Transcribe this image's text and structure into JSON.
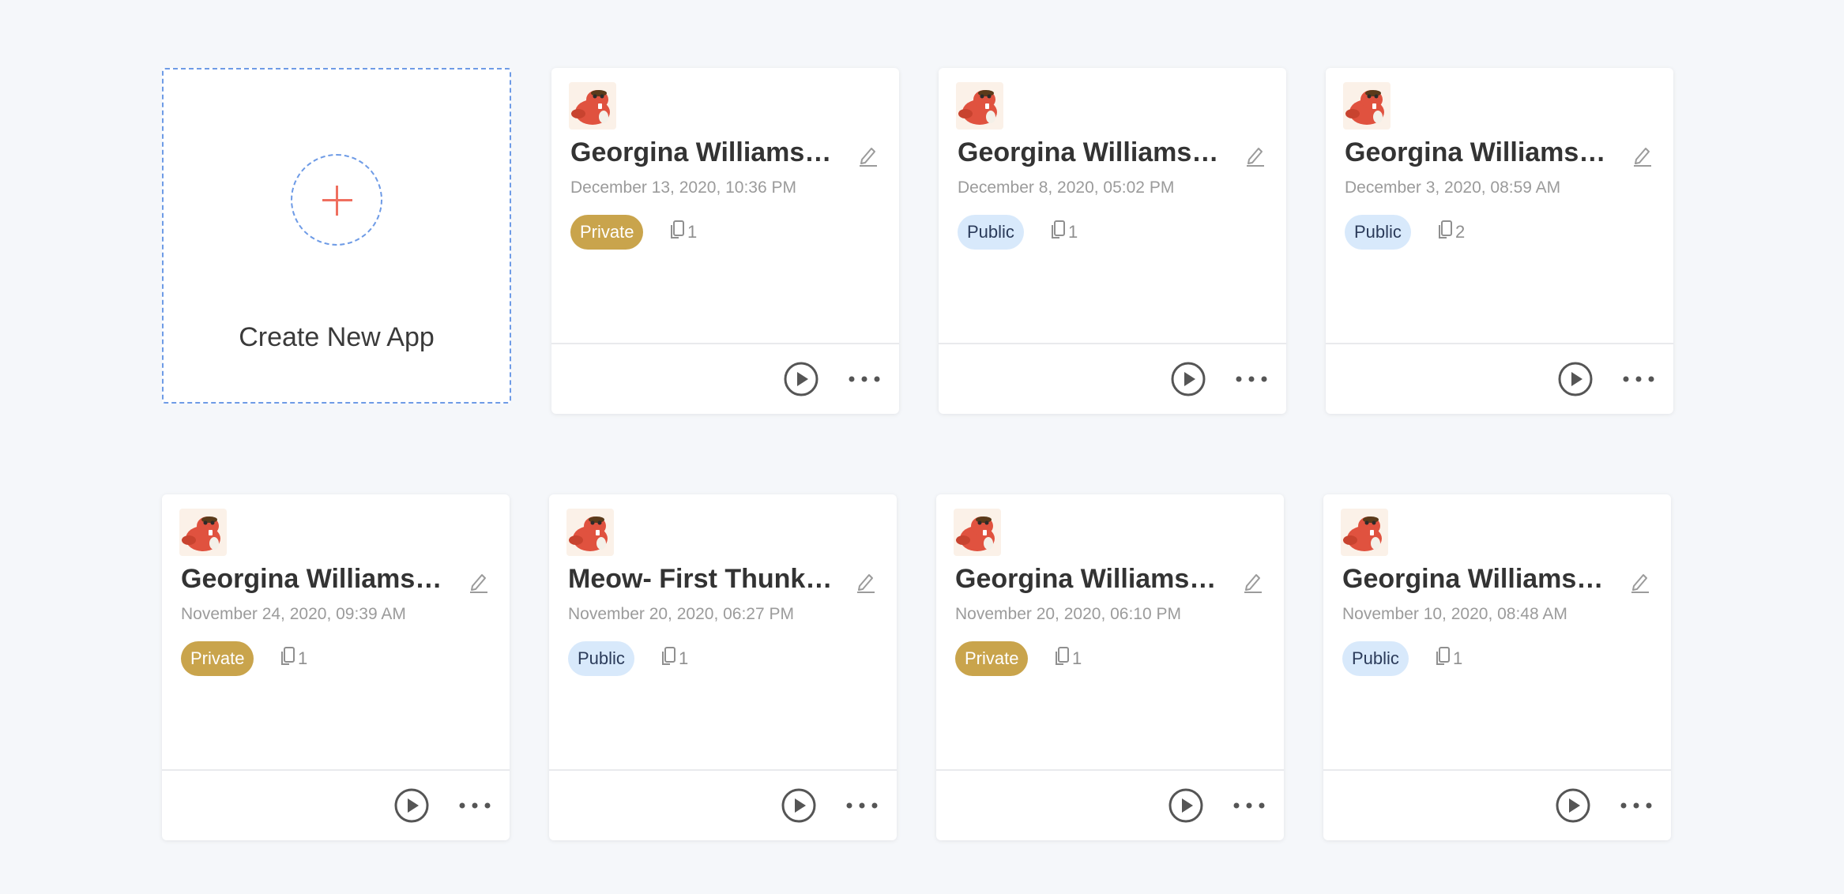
{
  "create_card": {
    "label": "Create New App",
    "icon": "plus-icon",
    "accent_color": "#ef6f5f",
    "border_color": "#6e9be6"
  },
  "apps": [
    {
      "title": "Georgina Williams- Lan…",
      "date": "December 13, 2020, 10:36 PM",
      "visibility": "Private",
      "count": "1"
    },
    {
      "title": "Georgina Williams- Lan…",
      "date": "December 8, 2020, 05:02 PM",
      "visibility": "Public",
      "count": "1"
    },
    {
      "title": "Georgina Williams- Lan…",
      "date": "December 3, 2020, 08:59 AM",
      "visibility": "Public",
      "count": "2"
    },
    {
      "title": "Georgina Williams- Lan…",
      "date": "November 24, 2020, 09:39 AM",
      "visibility": "Private",
      "count": "1"
    },
    {
      "title": "Meow- First Thunkable…",
      "date": "November 20, 2020, 06:27 PM",
      "visibility": "Public",
      "count": "1"
    },
    {
      "title": "Georgina Williams- Lan…",
      "date": "November 20, 2020, 06:10 PM",
      "visibility": "Private",
      "count": "1"
    },
    {
      "title": "Georgina Williams- Lan…",
      "date": "November 10, 2020, 08:48 AM",
      "visibility": "Public",
      "count": "1"
    }
  ],
  "icons": {
    "avatar": "beaver-avatar-icon",
    "edit": "pencil-icon",
    "copies": "copy-icon",
    "play": "play-icon",
    "more": "more-horizontal-icon"
  },
  "colors": {
    "private_badge": "#c9a44c",
    "public_badge": "#d8e9fb",
    "background": "#f5f7fa"
  }
}
